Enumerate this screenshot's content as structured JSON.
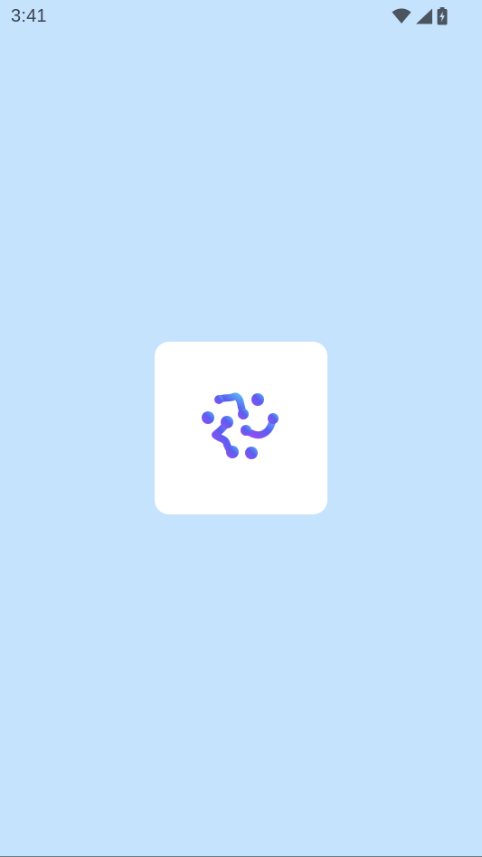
{
  "status_bar": {
    "time": "3:41",
    "icons": [
      "wifi-icon",
      "cellular-signal-icon",
      "battery-charging-icon"
    ]
  },
  "splash": {
    "logo_icon": "molecule-logo-icon"
  },
  "colors": {
    "background": "#c6e3fd",
    "card": "#ffffff",
    "logo_gradient_start": "#9b4cf0",
    "logo_gradient_mid": "#5a5ef0",
    "logo_gradient_end": "#5ab8f5",
    "status_icon": "#4a5560"
  }
}
